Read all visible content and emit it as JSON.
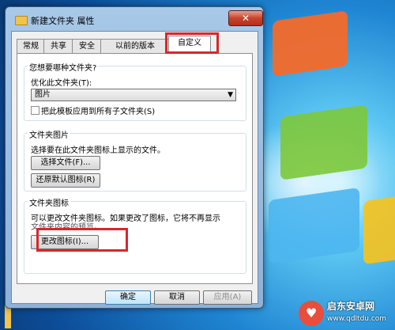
{
  "window": {
    "title": "新建文件夹 属性",
    "close_glyph": "✕"
  },
  "tabs": [
    {
      "label": "常规"
    },
    {
      "label": "共享"
    },
    {
      "label": "安全"
    },
    {
      "label": "以前的版本"
    },
    {
      "label": "自定义",
      "active": true
    }
  ],
  "folder_type": {
    "group_title": "您想要哪种文件夹?",
    "optimize_label": "优化此文件夹(T):",
    "selected_option": "图片",
    "apply_subfolders_label": "把此模板应用到所有子文件夹(S)",
    "apply_subfolders_checked": false
  },
  "folder_picture": {
    "group_title": "文件夹图片",
    "description": "选择要在此文件夹图标上显示的文件。",
    "choose_file_button": "选择文件(F)...",
    "restore_default_button": "还原默认图标(R)"
  },
  "folder_icon": {
    "group_title": "文件夹图标",
    "description_line1": "可以更改文件夹图标。如果更改了图标，它将不再显示",
    "description_line2": "文件夹内容的预览。",
    "change_icon_button": "更改图标(I)..."
  },
  "footer": {
    "ok_button": "确定",
    "cancel_button": "取消",
    "apply_button": "应用(A)"
  },
  "watermark": {
    "brand": "启东安卓网",
    "url": "www.qdltdu.com",
    "logo_glyph": "♥"
  },
  "colors": {
    "highlight": "#d9262a",
    "window_frame": "#8fb1d6"
  }
}
